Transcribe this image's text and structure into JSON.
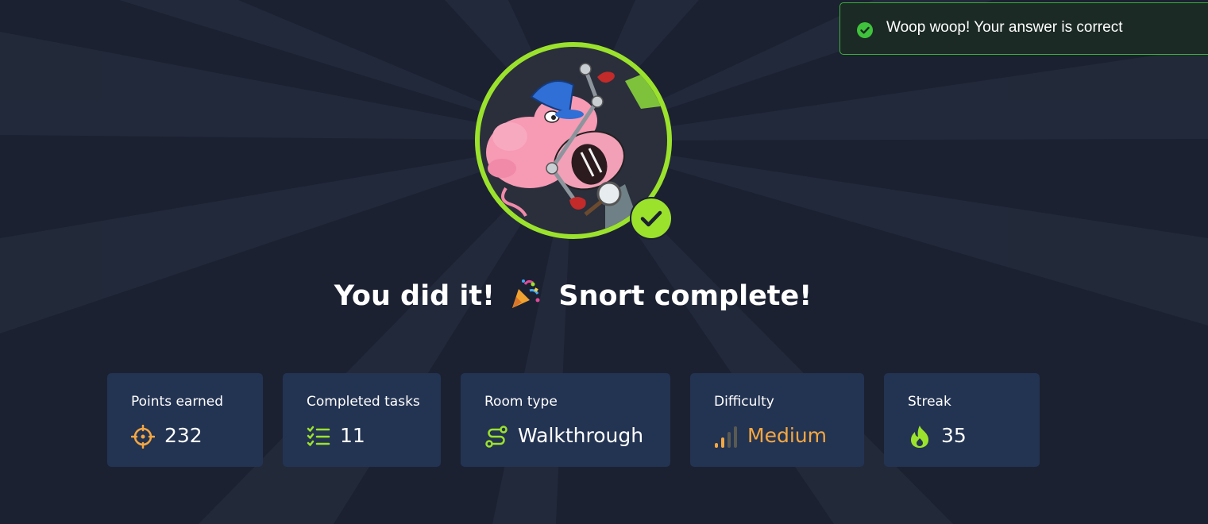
{
  "toast": {
    "message": "Woop woop! Your answer is correct",
    "icon": "check-circle-icon",
    "accent": "#3fae3c"
  },
  "avatar": {
    "icon": "snort-pig-mascot",
    "ring_color": "#9be22d",
    "badge_icon": "check-icon"
  },
  "headline": {
    "prefix": "You did it!",
    "emoji": "party-popper-icon",
    "suffix": "Snort complete!"
  },
  "stats": [
    {
      "label": "Points earned",
      "value": "232",
      "icon": "target-icon"
    },
    {
      "label": "Completed tasks",
      "value": "11",
      "icon": "task-list-icon"
    },
    {
      "label": "Room type",
      "value": "Walkthrough",
      "icon": "route-icon"
    },
    {
      "label": "Difficulty",
      "value": "Medium",
      "icon": "signal-bars-icon"
    },
    {
      "label": "Streak",
      "value": "35",
      "icon": "flame-icon"
    }
  ],
  "colors": {
    "background": "#1b2131",
    "card": "#233352",
    "medium": "#f5a742",
    "green": "#9be22d"
  }
}
